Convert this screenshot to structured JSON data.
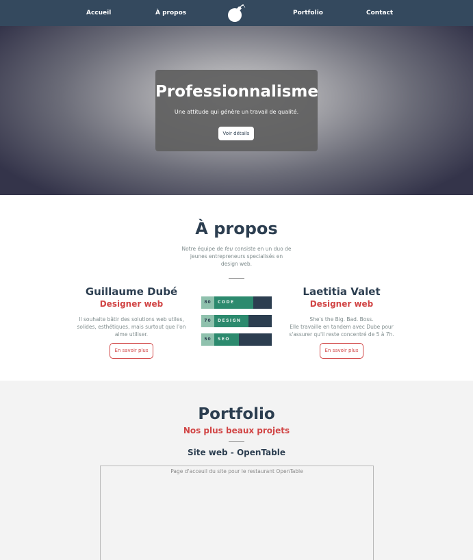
{
  "nav": {
    "items": [
      {
        "label": "Accueil"
      },
      {
        "label": "À propos"
      },
      {
        "label": "Portfolio"
      },
      {
        "label": "Contact"
      }
    ],
    "logo_icon": "bomb-icon"
  },
  "hero": {
    "title": "Professionnalisme",
    "subtitle": "Une attitude qui génère un travail de qualité.",
    "button_label": "Voir détails"
  },
  "about": {
    "title": "À propos",
    "intro_before": "Notre équipe de ",
    "intro_em": "feu",
    "intro_after": " consiste en un duo de jeunes entrepreneurs specialisés en design web.",
    "people": [
      {
        "name": "Guillaume Dubé",
        "role": "Designer web",
        "description": "Il souhaite bâtir des solutions web utiles, solides, esthétiques, mais surtout que l'on aime utiliser.",
        "button_label": "En savoir plus"
      },
      {
        "name": "Laetitia Valet",
        "role": "Designer web",
        "description_line1": "She's the Big. Bad. Boss.",
        "description_line2": "Elle travaille en tandem avec Dube pour s'assurer qu'il reste concentré de 5 à 7h.",
        "button_label": "En savoir plus"
      }
    ],
    "skills": [
      {
        "value": "80",
        "label": "CODE",
        "percent": 80
      },
      {
        "value": "70",
        "label": "DESIGN",
        "percent": 70
      },
      {
        "value": "50",
        "label": "SEO",
        "percent": 50
      }
    ]
  },
  "portfolio": {
    "title": "Portfolio",
    "subtitle": "Nos plus beaux projets",
    "project": {
      "title": "Site web - OpenTable",
      "caption": "Page d'acceuil du site pour le restaurant OpenTable"
    }
  },
  "colors": {
    "nav_bg": "#34495e",
    "heading": "#2c3e50",
    "accent_red": "#d14545",
    "skill_fill": "#2c8a6e",
    "skill_num_bg": "#8fc1ad"
  }
}
